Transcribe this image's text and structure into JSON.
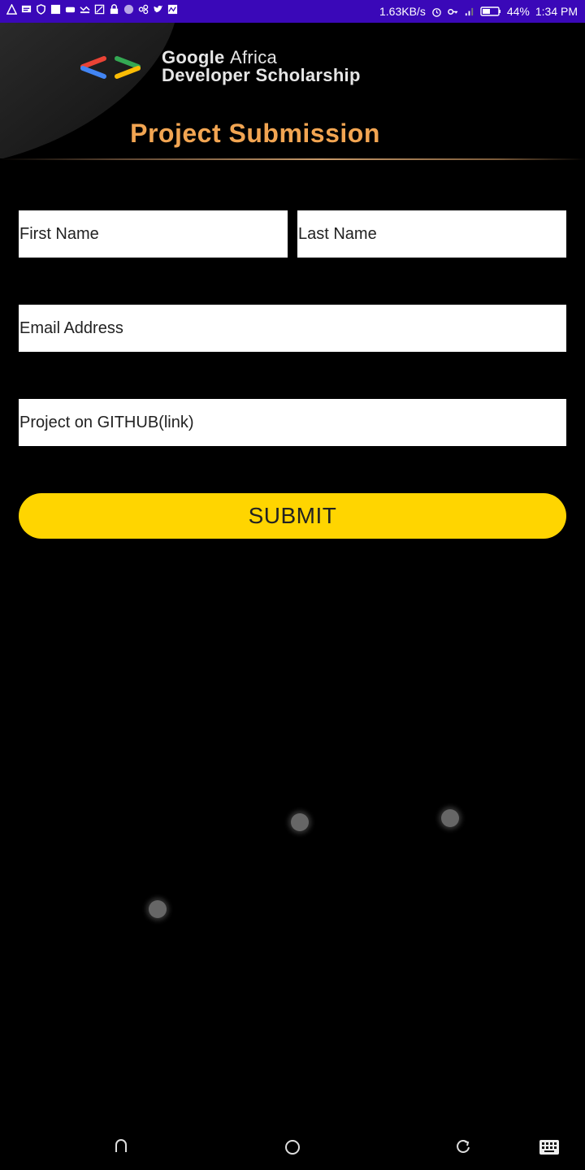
{
  "status_bar": {
    "network_speed": "1.63KB/s",
    "battery": "44%",
    "time": "1:34 PM",
    "background_color": "#3a08b8",
    "left_icons": [
      "warning-icon",
      "message-icon",
      "shield-icon",
      "square-icon",
      "voicemail-icon",
      "missed-call-icon",
      "screenshot-icon",
      "lock-icon",
      "circle-icon",
      "connect-icon",
      "twitter-icon",
      "activity-icon"
    ],
    "right_icons": [
      "alarm-icon",
      "key-icon",
      "signal-icon",
      "battery-icon"
    ]
  },
  "header": {
    "brand_line1_bold": "Google",
    "brand_line1_rest": "Africa",
    "brand_line2": "Developer Scholarship",
    "page_title": "Project Submission",
    "title_color": "#f2a552"
  },
  "form": {
    "first_name_placeholder": "First Name",
    "last_name_placeholder": "Last Name",
    "email_placeholder": "Email Address",
    "github_placeholder": "Project on GITHUB(link)",
    "submit_label": "SUBMIT",
    "submit_color": "#ffd500"
  },
  "nav_bar": {
    "icons": [
      "back-icon",
      "home-icon",
      "recents-icon",
      "keyboard-icon"
    ]
  }
}
